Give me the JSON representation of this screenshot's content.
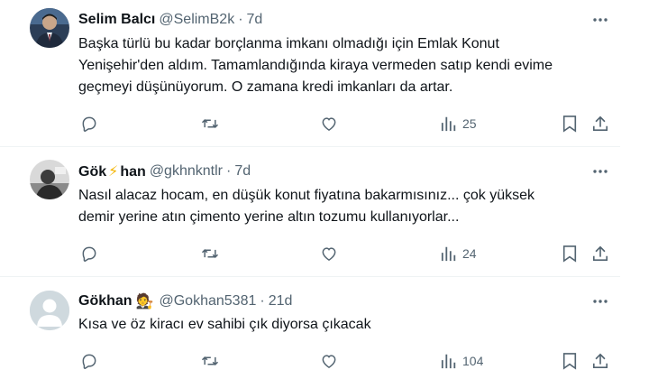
{
  "tweets": [
    {
      "name": "Selim Balcı",
      "emoji": "",
      "handle": "@SelimB2k",
      "time": "7d",
      "lines": [
        "Başka türlü bu kadar borçlanma imkanı olmadığı için Emlak Konut",
        "Yenişehir'den aldım. Tamamlandığında kiraya vermeden satıp kendi evime",
        "geçmeyi düşünüyorum. O zamana kredi imkanları da artar."
      ],
      "views": "25",
      "avatar": "photo-man-suit"
    },
    {
      "name_part1": "Gök",
      "emoji": "⚡",
      "name_part2": "han",
      "handle": "@gkhnkntlr",
      "time": "7d",
      "lines": [
        "Nasıl alacaz hocam, en düşük konut fiyatına bakarmısınız... çok yüksek",
        "demir yerine atın çimento yerine altın tozumu kullanıyorlar..."
      ],
      "views": "24",
      "avatar": "photo-bw"
    },
    {
      "name": "Gökhan",
      "emoji": "🧑‍⚖️",
      "handle": "@Gokhan5381",
      "time": "21d",
      "lines": [
        "Kısa ve öz kiracı ev sahibi çık diyorsa çıkacak"
      ],
      "views": "104",
      "avatar": "default-avatar"
    }
  ],
  "colors": {
    "text": "#0f1419",
    "muted": "#536471",
    "separator": "#eff3f4",
    "default_avatar_bg": "#cfd9de"
  },
  "icons": [
    "reply-icon",
    "retweet-icon",
    "like-icon",
    "views-icon",
    "bookmark-icon",
    "share-icon",
    "more-icon"
  ]
}
